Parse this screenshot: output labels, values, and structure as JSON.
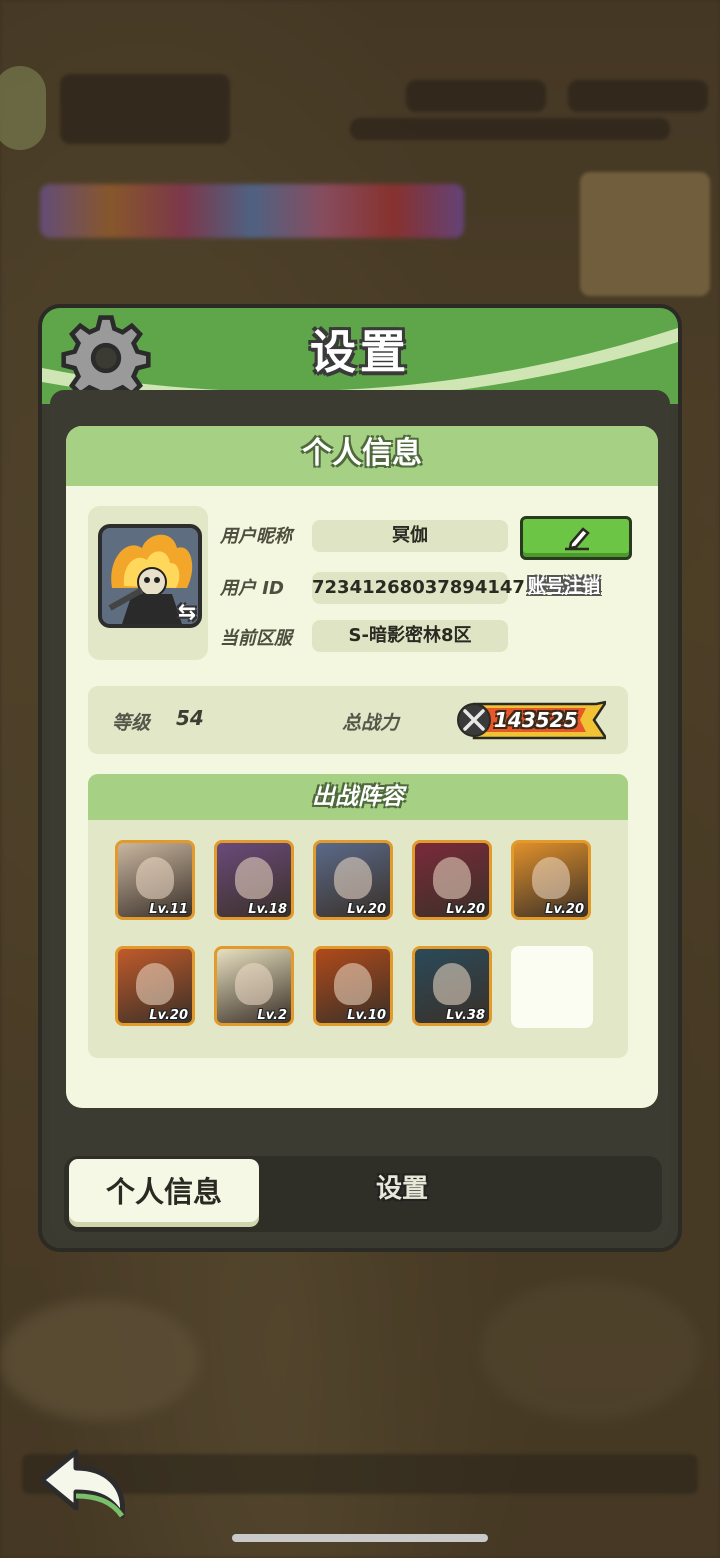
{
  "panel": {
    "title": "设置"
  },
  "profile": {
    "section_title": "个人信息",
    "nickname_label": "用户昵称",
    "nickname": "冥伽",
    "id_label": "用户 ID",
    "user_id": "72341268037894147",
    "server_label": "当前区服",
    "server": "S-暗影密林8区",
    "cancel_account_label": "账号注销",
    "edit_icon": "pencil-icon",
    "swap_icon": "swap-arrows-icon"
  },
  "stats": {
    "level_label": "等级",
    "level": "54",
    "power_label": "总战力",
    "power": "143525",
    "power_icon": "crossed-swords-icon"
  },
  "lineup": {
    "title": "出战阵容",
    "heroes": [
      {
        "level": "Lv.11",
        "color": "#c9b6a0"
      },
      {
        "level": "Lv.18",
        "color": "#6a4a7a"
      },
      {
        "level": "Lv.20",
        "color": "#5a6a8a"
      },
      {
        "level": "Lv.20",
        "color": "#7a2a3a"
      },
      {
        "level": "Lv.20",
        "color": "#e0902a"
      },
      {
        "level": "Lv.20",
        "color": "#c05a2a"
      },
      {
        "level": "Lv.2",
        "color": "#e8e0c0"
      },
      {
        "level": "Lv.10",
        "color": "#b04a1a"
      },
      {
        "level": "Lv.38",
        "color": "#2a4a5a"
      }
    ]
  },
  "tabs": {
    "active": "个人信息",
    "inactive": "设置"
  },
  "colors": {
    "accent_green": "#6cc545",
    "header_green": "#5fa64b",
    "card_bg": "#f3f7df",
    "hero_border": "#e29a2a"
  }
}
